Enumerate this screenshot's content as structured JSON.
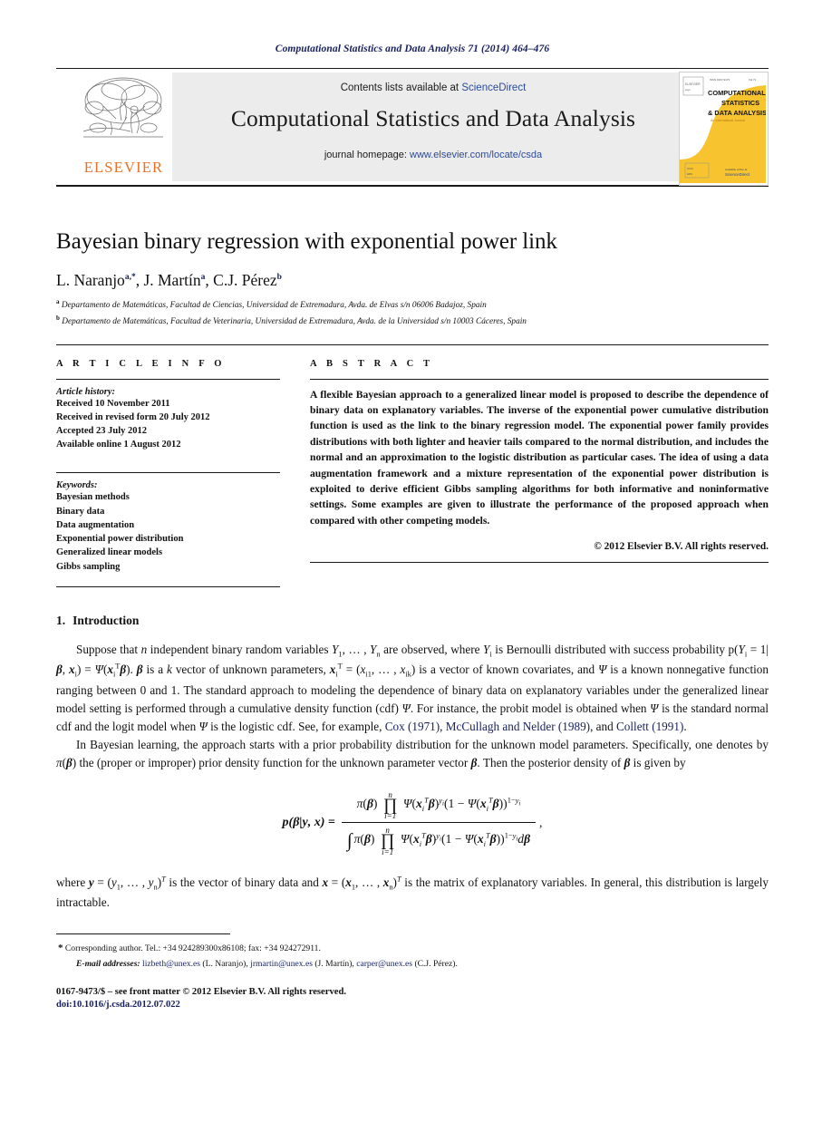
{
  "running_head": "Computational Statistics and Data Analysis 71 (2014) 464–476",
  "masthead": {
    "contents_prefix": "Contents lists available at",
    "sciencedirect": "ScienceDirect",
    "journal_title": "Computational Statistics and Data Analysis",
    "homepage_prefix": "journal homepage:",
    "homepage_url": "www.elsevier.com/locate/csda",
    "publisher_name": "ELSEVIER",
    "publisher_accent": "#ea7125",
    "band_bg": "#ececec",
    "link_color": "#2b4a9b",
    "cover": {
      "line1": "COMPUTATIONAL",
      "line2": "STATISTICS",
      "line3": "& DATA ANALYSIS",
      "subtitle": "An International Journal",
      "footer": "ScienceDirect",
      "accent": "#f7c430"
    }
  },
  "article": {
    "title": "Bayesian binary regression with exponential power link",
    "authors": [
      {
        "name": "L. Naranjo",
        "marks": "a,*"
      },
      {
        "name": "J. Martín",
        "marks": "a"
      },
      {
        "name": "C.J. Pérez",
        "marks": "b"
      }
    ],
    "affiliations": [
      {
        "mark": "a",
        "text": "Departamento de Matemáticas, Facultad de Ciencias, Universidad de Extremadura, Avda. de Elvas s/n 06006 Badajoz, Spain"
      },
      {
        "mark": "b",
        "text": "Departamento de Matemáticas, Facultad de Veterinaria, Universidad de Extremadura, Avda. de la Universidad s/n 10003 Cáceres, Spain"
      }
    ]
  },
  "info": {
    "heading": "A R T I C L E   I N F O",
    "history_label": "Article history:",
    "history": [
      "Received 10 November 2011",
      "Received in revised form 20 July 2012",
      "Accepted 23 July 2012",
      "Available online 1 August 2012"
    ],
    "keywords_label": "Keywords:",
    "keywords": [
      "Bayesian methods",
      "Binary data",
      "Data augmentation",
      "Exponential power distribution",
      "Generalized linear models",
      "Gibbs sampling"
    ]
  },
  "abstract": {
    "heading": "A B S T R A C T",
    "text": "A flexible Bayesian approach to a generalized linear model is proposed to describe the dependence of binary data on explanatory variables. The inverse of the exponential power cumulative distribution function is used as the link to the binary regression model. The exponential power family provides distributions with both lighter and heavier tails compared to the normal distribution, and includes the normal and an approximation to the logistic distribution as particular cases. The idea of using a data augmentation framework and a mixture representation of the exponential power distribution is exploited to derive efficient Gibbs sampling algorithms for both informative and noninformative settings. Some examples are given to illustrate the performance of the proposed approach when compared with other competing models.",
    "copyright": "© 2012 Elsevier B.V. All rights reserved."
  },
  "body": {
    "section_number": "1.",
    "section_title": "Introduction",
    "paragraph1_pre": "Suppose that ",
    "paragraph1": "Suppose that n independent binary random variables Y1, …, Yn are observed, where Yi is Bernoulli distributed with success probability p(Yi = 1|β, xi) = Ψ(xiTβ). β is a k vector of unknown parameters, xiT = (xi1, …, xik) is a vector of known covariates, and Ψ is a known nonnegative function ranging between 0 and 1. The standard approach to modeling the dependence of binary data on explanatory variables under the generalized linear model setting is performed through a cumulative density function (cdf) Ψ. For instance, the probit model is obtained when Ψ is the standard normal cdf and the logit model when Ψ is the logistic cdf. See, for example, Cox (1971), McCullagh and Nelder (1989), and Collett (1991).",
    "citations": [
      "Cox (1971)",
      "McCullagh and Nelder (1989)",
      "Collett (1991)"
    ],
    "paragraph2": "In Bayesian learning, the approach starts with a prior probability distribution for the unknown model parameters. Specifically, one denotes by π(β) the (proper or improper) prior density function for the unknown parameter vector β. Then the posterior density of β is given by",
    "paragraph3": "where y = (y1, …, yn)T is the vector of binary data and x = (x1, …, xn)T is the matrix of explanatory variables. In general, this distribution is largely intractable.",
    "equation": {
      "lhs": "p(β|y, x) =",
      "numerator": "π(β) ∏ Ψ(xiTβ)yi (1 − Ψ(xiTβ))1−yi",
      "denominator": "∫ π(β) ∏ Ψ(xiTβ)yi (1 − Ψ(xiTβ))1−yi dβ",
      "product_upper": "n",
      "product_lower": "i=1",
      "trailing": ","
    }
  },
  "footnotes": {
    "corresponding": "Corresponding author. Tel.: +34 924289300x86108; fax: +34 924272911.",
    "email_label": "E-mail addresses:",
    "emails": [
      {
        "address": "lizbeth@unex.es",
        "who": "(L. Naranjo)"
      },
      {
        "address": "jrmartin@unex.es",
        "who": "(J. Martín)"
      },
      {
        "address": "carper@unex.es",
        "who": "(C.J. Pérez)"
      }
    ],
    "imprint": "0167-9473/$ – see front matter © 2012 Elsevier B.V. All rights reserved.",
    "doi": "doi:10.1016/j.csda.2012.07.022"
  }
}
